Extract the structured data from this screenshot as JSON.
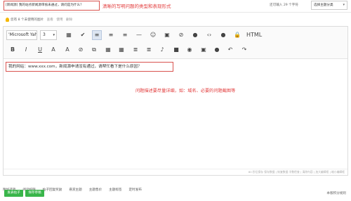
{
  "title_row": {
    "title_value": "[新闻源] 我的站点新闻源审核未通过，请问是为什么？",
    "annotation": "清晰的写明问题的类型和表现形式",
    "remaining": "还可输入 29 个字符",
    "category": "选择主题分类"
  },
  "attach": {
    "tip": "您有 8 个未使用的图片",
    "links": [
      "查看",
      "使用",
      "删除"
    ]
  },
  "toolbar": {
    "font": "'Microsoft Yahei'",
    "size": "3",
    "row1_icons": [
      "table-icon",
      "clear-format-icon",
      "align-left-icon",
      "align-center-icon",
      "align-right-icon",
      "horizontal-rule-icon",
      "emoji-icon",
      "image-icon",
      "attachment-icon",
      "video-icon",
      "code-icon",
      "quote-icon",
      "hide-icon",
      "html-icon"
    ],
    "row1_glyphs": [
      "▦",
      "✔",
      "≡",
      "≡",
      "≡",
      "—",
      "☺",
      "▣",
      "⊘",
      "●",
      "‹›",
      "●",
      "🔒",
      "HTML"
    ],
    "row2_labels": [
      "B",
      "I",
      "U",
      "A",
      "A",
      "⊘",
      "⧉",
      "▦",
      "▦",
      "≣",
      "≣",
      "♪",
      "■",
      "◉",
      "▣",
      "●",
      "↶",
      "↷"
    ]
  },
  "editor": {
    "content": "我的网站：www.xxx.com，新闻源申请没有通过，请帮忙看下是什么原因？",
    "annotation": "问题描述要尽量详细，如：域名、必要的问题截图等",
    "status": "80 秒后保存 保存数据 | 恢复数据      字数检查 | 清除内容 | 加大编辑框 | 缩小编辑框"
  },
  "options": [
    "附加选项",
    "阅读权限",
    "帖子回复奖励",
    "悬赏主题",
    "主题售价",
    "主题标签",
    "定时发布"
  ],
  "actions": {
    "submit": "发表帖子",
    "draft": "保存草稿",
    "rules": "本版积分规则"
  }
}
